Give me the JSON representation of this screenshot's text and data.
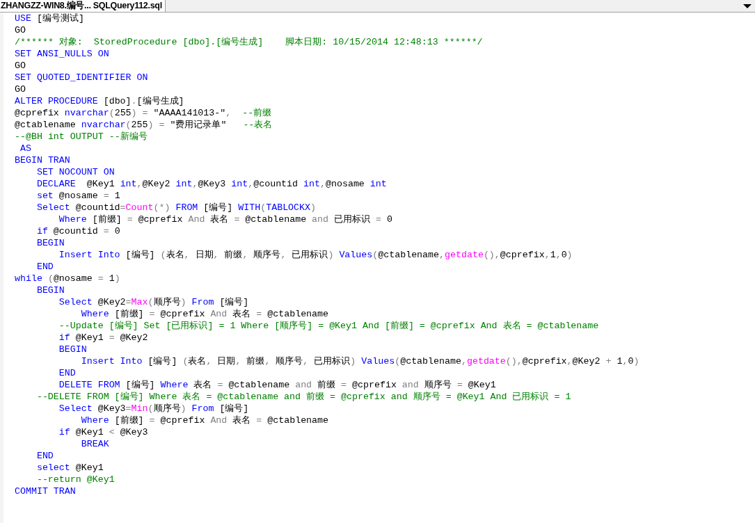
{
  "tab": {
    "title": "ZHANGZZ-WIN8.编号... SQLQuery112.sql",
    "selected": true
  },
  "editor": {
    "lines": [
      [
        {
          "kind": "keyword",
          "text": "USE "
        },
        {
          "kind": "plain",
          "text": "[编号测试]"
        }
      ],
      [
        {
          "kind": "plain",
          "text": "GO"
        }
      ],
      [
        {
          "kind": "comment",
          "text": "/****** 对象:  StoredProcedure [dbo].[编号生成]    脚本日期: 10/15/2014 12:48:13 ******/"
        }
      ],
      [
        {
          "kind": "keyword",
          "text": "SET ANSI_NULLS ON"
        }
      ],
      [
        {
          "kind": "plain",
          "text": "GO"
        }
      ],
      [
        {
          "kind": "keyword",
          "text": "SET QUOTED_IDENTIFIER ON"
        }
      ],
      [
        {
          "kind": "plain",
          "text": "GO"
        }
      ],
      [
        {
          "kind": "keyword",
          "text": "ALTER PROCEDURE "
        },
        {
          "kind": "plain",
          "text": "[dbo]"
        },
        {
          "kind": "operator",
          "text": "."
        },
        {
          "kind": "plain",
          "text": "[编号生成]"
        }
      ],
      [
        {
          "kind": "plain",
          "text": "@cprefix "
        },
        {
          "kind": "keyword",
          "text": "nvarchar"
        },
        {
          "kind": "operator",
          "text": "("
        },
        {
          "kind": "plain",
          "text": "255"
        },
        {
          "kind": "operator",
          "text": ") = "
        },
        {
          "kind": "plain",
          "text": "\"AAAA141013-\""
        },
        {
          "kind": "operator",
          "text": ",  "
        },
        {
          "kind": "comment",
          "text": "--前缀"
        }
      ],
      [
        {
          "kind": "plain",
          "text": "@ctablename "
        },
        {
          "kind": "keyword",
          "text": "nvarchar"
        },
        {
          "kind": "operator",
          "text": "("
        },
        {
          "kind": "plain",
          "text": "255"
        },
        {
          "kind": "operator",
          "text": ") = "
        },
        {
          "kind": "plain",
          "text": "\"费用记录单\"   "
        },
        {
          "kind": "comment",
          "text": "--表名"
        }
      ],
      [
        {
          "kind": "comment",
          "text": "--@BH int OUTPUT --新编号"
        }
      ],
      [
        {
          "kind": "keyword",
          "text": " AS"
        }
      ],
      [
        {
          "kind": "keyword",
          "text": "BEGIN TRAN"
        }
      ],
      [
        {
          "kind": "keyword",
          "text": "    SET NOCOUNT ON"
        }
      ],
      [
        {
          "kind": "keyword",
          "text": "    DECLARE  "
        },
        {
          "kind": "plain",
          "text": "@Key1 "
        },
        {
          "kind": "keyword",
          "text": "int"
        },
        {
          "kind": "operator",
          "text": ","
        },
        {
          "kind": "plain",
          "text": "@Key2 "
        },
        {
          "kind": "keyword",
          "text": "int"
        },
        {
          "kind": "operator",
          "text": ","
        },
        {
          "kind": "plain",
          "text": "@Key3 "
        },
        {
          "kind": "keyword",
          "text": "int"
        },
        {
          "kind": "operator",
          "text": ","
        },
        {
          "kind": "plain",
          "text": "@countid "
        },
        {
          "kind": "keyword",
          "text": "int"
        },
        {
          "kind": "operator",
          "text": ","
        },
        {
          "kind": "plain",
          "text": "@nosame "
        },
        {
          "kind": "keyword",
          "text": "int"
        }
      ],
      [
        {
          "kind": "keyword",
          "text": "    set "
        },
        {
          "kind": "plain",
          "text": "@nosame "
        },
        {
          "kind": "operator",
          "text": "= "
        },
        {
          "kind": "plain",
          "text": "1"
        }
      ],
      [
        {
          "kind": "keyword",
          "text": "    Select "
        },
        {
          "kind": "plain",
          "text": "@countid"
        },
        {
          "kind": "operator",
          "text": "="
        },
        {
          "kind": "function",
          "text": "Count"
        },
        {
          "kind": "operator",
          "text": "(*) "
        },
        {
          "kind": "keyword",
          "text": "FROM "
        },
        {
          "kind": "plain",
          "text": "[编号] "
        },
        {
          "kind": "keyword",
          "text": "WITH"
        },
        {
          "kind": "operator",
          "text": "("
        },
        {
          "kind": "keyword",
          "text": "TABLOCKX"
        },
        {
          "kind": "operator",
          "text": ")"
        }
      ],
      [
        {
          "kind": "keyword",
          "text": "        Where "
        },
        {
          "kind": "plain",
          "text": "[前缀] "
        },
        {
          "kind": "operator",
          "text": "= "
        },
        {
          "kind": "plain",
          "text": "@cprefix "
        },
        {
          "kind": "operator",
          "text": "And "
        },
        {
          "kind": "plain",
          "text": "表名 "
        },
        {
          "kind": "operator",
          "text": "= "
        },
        {
          "kind": "plain",
          "text": "@ctablename "
        },
        {
          "kind": "operator",
          "text": "and "
        },
        {
          "kind": "plain",
          "text": "已用标识 "
        },
        {
          "kind": "operator",
          "text": "= "
        },
        {
          "kind": "plain",
          "text": "0"
        }
      ],
      [
        {
          "kind": "keyword",
          "text": "    if "
        },
        {
          "kind": "plain",
          "text": "@countid "
        },
        {
          "kind": "operator",
          "text": "= "
        },
        {
          "kind": "plain",
          "text": "0"
        }
      ],
      [
        {
          "kind": "keyword",
          "text": "    BEGIN"
        }
      ],
      [
        {
          "kind": "keyword",
          "text": "        Insert Into "
        },
        {
          "kind": "plain",
          "text": "[编号] "
        },
        {
          "kind": "operator",
          "text": "("
        },
        {
          "kind": "plain",
          "text": "表名"
        },
        {
          "kind": "operator",
          "text": ", "
        },
        {
          "kind": "plain",
          "text": "日期"
        },
        {
          "kind": "operator",
          "text": ", "
        },
        {
          "kind": "plain",
          "text": "前缀"
        },
        {
          "kind": "operator",
          "text": ", "
        },
        {
          "kind": "plain",
          "text": "顺序号"
        },
        {
          "kind": "operator",
          "text": ", "
        },
        {
          "kind": "plain",
          "text": "已用标识"
        },
        {
          "kind": "operator",
          "text": ") "
        },
        {
          "kind": "keyword",
          "text": "Values"
        },
        {
          "kind": "operator",
          "text": "("
        },
        {
          "kind": "plain",
          "text": "@ctablename"
        },
        {
          "kind": "operator",
          "text": ","
        },
        {
          "kind": "function",
          "text": "getdate"
        },
        {
          "kind": "operator",
          "text": "(),"
        },
        {
          "kind": "plain",
          "text": "@cprefix"
        },
        {
          "kind": "operator",
          "text": ","
        },
        {
          "kind": "plain",
          "text": "1"
        },
        {
          "kind": "operator",
          "text": ","
        },
        {
          "kind": "plain",
          "text": "0"
        },
        {
          "kind": "operator",
          "text": ")"
        }
      ],
      [
        {
          "kind": "keyword",
          "text": "    END"
        }
      ],
      [
        {
          "kind": "keyword",
          "text": "while "
        },
        {
          "kind": "operator",
          "text": "("
        },
        {
          "kind": "plain",
          "text": "@nosame "
        },
        {
          "kind": "operator",
          "text": "= "
        },
        {
          "kind": "plain",
          "text": "1"
        },
        {
          "kind": "operator",
          "text": ")"
        }
      ],
      [
        {
          "kind": "keyword",
          "text": "    BEGIN"
        }
      ],
      [
        {
          "kind": "keyword",
          "text": "        Select "
        },
        {
          "kind": "plain",
          "text": "@Key2"
        },
        {
          "kind": "operator",
          "text": "="
        },
        {
          "kind": "function",
          "text": "Max"
        },
        {
          "kind": "operator",
          "text": "("
        },
        {
          "kind": "plain",
          "text": "顺序号"
        },
        {
          "kind": "operator",
          "text": ") "
        },
        {
          "kind": "keyword",
          "text": "From "
        },
        {
          "kind": "plain",
          "text": "[编号]"
        }
      ],
      [
        {
          "kind": "keyword",
          "text": "            Where "
        },
        {
          "kind": "plain",
          "text": "[前缀] "
        },
        {
          "kind": "operator",
          "text": "= "
        },
        {
          "kind": "plain",
          "text": "@cprefix "
        },
        {
          "kind": "operator",
          "text": "And "
        },
        {
          "kind": "plain",
          "text": "表名 "
        },
        {
          "kind": "operator",
          "text": "= "
        },
        {
          "kind": "plain",
          "text": "@ctablename"
        }
      ],
      [
        {
          "kind": "comment",
          "text": "        --Update [编号] Set [已用标识] = 1 Where [顺序号] = @Key1 And [前缀] = @cprefix And 表名 = @ctablename"
        }
      ],
      [
        {
          "kind": "keyword",
          "text": "        if "
        },
        {
          "kind": "plain",
          "text": "@Key1 "
        },
        {
          "kind": "operator",
          "text": "= "
        },
        {
          "kind": "plain",
          "text": "@Key2"
        }
      ],
      [
        {
          "kind": "keyword",
          "text": "        BEGIN"
        }
      ],
      [
        {
          "kind": "keyword",
          "text": "            Insert Into "
        },
        {
          "kind": "plain",
          "text": "[编号] "
        },
        {
          "kind": "operator",
          "text": "("
        },
        {
          "kind": "plain",
          "text": "表名"
        },
        {
          "kind": "operator",
          "text": ", "
        },
        {
          "kind": "plain",
          "text": "日期"
        },
        {
          "kind": "operator",
          "text": ", "
        },
        {
          "kind": "plain",
          "text": "前缀"
        },
        {
          "kind": "operator",
          "text": ", "
        },
        {
          "kind": "plain",
          "text": "顺序号"
        },
        {
          "kind": "operator",
          "text": ", "
        },
        {
          "kind": "plain",
          "text": "已用标识"
        },
        {
          "kind": "operator",
          "text": ") "
        },
        {
          "kind": "keyword",
          "text": "Values"
        },
        {
          "kind": "operator",
          "text": "("
        },
        {
          "kind": "plain",
          "text": "@ctablename"
        },
        {
          "kind": "operator",
          "text": ","
        },
        {
          "kind": "function",
          "text": "getdate"
        },
        {
          "kind": "operator",
          "text": "(),"
        },
        {
          "kind": "plain",
          "text": "@cprefix"
        },
        {
          "kind": "operator",
          "text": ","
        },
        {
          "kind": "plain",
          "text": "@Key2 "
        },
        {
          "kind": "operator",
          "text": "+ "
        },
        {
          "kind": "plain",
          "text": "1"
        },
        {
          "kind": "operator",
          "text": ","
        },
        {
          "kind": "plain",
          "text": "0"
        },
        {
          "kind": "operator",
          "text": ")"
        }
      ],
      [
        {
          "kind": "keyword",
          "text": "        END"
        }
      ],
      [
        {
          "kind": "keyword",
          "text": "        DELETE FROM "
        },
        {
          "kind": "plain",
          "text": "[编号] "
        },
        {
          "kind": "keyword",
          "text": "Where "
        },
        {
          "kind": "plain",
          "text": "表名 "
        },
        {
          "kind": "operator",
          "text": "= "
        },
        {
          "kind": "plain",
          "text": "@ctablename "
        },
        {
          "kind": "operator",
          "text": "and "
        },
        {
          "kind": "plain",
          "text": "前缀 "
        },
        {
          "kind": "operator",
          "text": "= "
        },
        {
          "kind": "plain",
          "text": "@cprefix "
        },
        {
          "kind": "operator",
          "text": "and "
        },
        {
          "kind": "plain",
          "text": "顺序号 "
        },
        {
          "kind": "operator",
          "text": "= "
        },
        {
          "kind": "plain",
          "text": "@Key1"
        }
      ],
      [
        {
          "kind": "comment",
          "text": "    --DELETE FROM [编号] Where 表名 = @ctablename and 前缀 = @cprefix and 顺序号 = @Key1 And 已用标识 = 1"
        }
      ],
      [
        {
          "kind": "keyword",
          "text": "        Select "
        },
        {
          "kind": "plain",
          "text": "@Key3"
        },
        {
          "kind": "operator",
          "text": "="
        },
        {
          "kind": "function",
          "text": "Min"
        },
        {
          "kind": "operator",
          "text": "("
        },
        {
          "kind": "plain",
          "text": "顺序号"
        },
        {
          "kind": "operator",
          "text": ") "
        },
        {
          "kind": "keyword",
          "text": "From "
        },
        {
          "kind": "plain",
          "text": "[编号]"
        }
      ],
      [
        {
          "kind": "keyword",
          "text": "            Where "
        },
        {
          "kind": "plain",
          "text": "[前缀] "
        },
        {
          "kind": "operator",
          "text": "= "
        },
        {
          "kind": "plain",
          "text": "@cprefix "
        },
        {
          "kind": "operator",
          "text": "And "
        },
        {
          "kind": "plain",
          "text": "表名 "
        },
        {
          "kind": "operator",
          "text": "= "
        },
        {
          "kind": "plain",
          "text": "@ctablename"
        }
      ],
      [
        {
          "kind": "keyword",
          "text": "        if "
        },
        {
          "kind": "plain",
          "text": "@Key1 "
        },
        {
          "kind": "operator",
          "text": "< "
        },
        {
          "kind": "plain",
          "text": "@Key3"
        }
      ],
      [
        {
          "kind": "keyword",
          "text": "            BREAK"
        }
      ],
      [
        {
          "kind": "keyword",
          "text": "    END"
        }
      ],
      [
        {
          "kind": "keyword",
          "text": "    select "
        },
        {
          "kind": "plain",
          "text": "@Key1"
        }
      ],
      [
        {
          "kind": "comment",
          "text": "    --return @Key1"
        }
      ],
      [
        {
          "kind": "keyword",
          "text": "COMMIT TRAN"
        }
      ]
    ]
  }
}
